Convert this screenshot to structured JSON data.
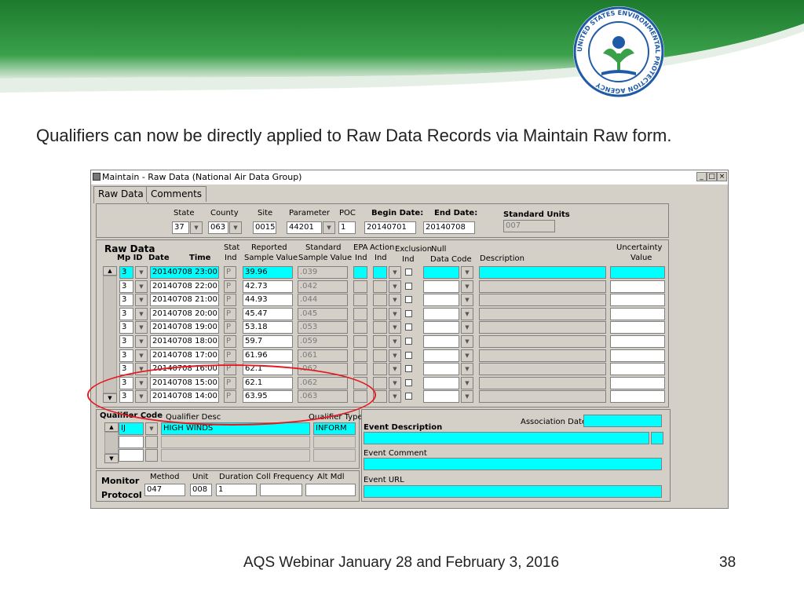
{
  "slide": {
    "caption": "Qualifiers can now be directly applied to Raw Data Records via Maintain Raw form.",
    "footer": "AQS Webinar January 28 and February 3, 2016",
    "page_number": "38",
    "seal_text": "UNITED STATES ENVIRONMENTAL PROTECTION AGENCY"
  },
  "window": {
    "title": "Maintain - Raw Data (National Air Data Group)",
    "tabs": [
      "Raw Data",
      "Comments"
    ]
  },
  "header": {
    "labels": {
      "state": "State",
      "county": "County",
      "site": "Site",
      "parameter": "Parameter",
      "poc": "POC",
      "begin_date": "Begin Date:",
      "end_date": "End Date:",
      "standard_units": "Standard Units"
    },
    "values": {
      "state": "37",
      "county": "063",
      "site": "0015",
      "parameter": "44201",
      "poc": "1",
      "begin_date": "20140701",
      "end_date": "20140708",
      "standard_units": "007"
    }
  },
  "raw_data": {
    "section_title": "Raw Data",
    "col_labels": {
      "mp_id": "Mp ID",
      "date": "Date",
      "time": "Time",
      "stat": "Stat",
      "ind": "Ind",
      "reported": "Reported",
      "sample_value": "Sample Value",
      "standard": "Standard",
      "sample_value2": "Sample  Value",
      "epa": "EPA",
      "action": "Action",
      "epa_ind": "Ind",
      "action_ind": "Ind",
      "exclusion": "Exclusion",
      "excl_ind": "Ind",
      "null": "Null",
      "data_code": "Data Code",
      "description": "Description",
      "uncertainty": "Uncertainty",
      "uncertainty_value": "Value"
    },
    "rows": [
      {
        "mp": "3",
        "datetime": "20140708 23:00",
        "stat": "P",
        "reported": "39.96",
        "standard": ".039"
      },
      {
        "mp": "3",
        "datetime": "20140708 22:00",
        "stat": "P",
        "reported": "42.73",
        "standard": ".042"
      },
      {
        "mp": "3",
        "datetime": "20140708 21:00",
        "stat": "P",
        "reported": "44.93",
        "standard": ".044"
      },
      {
        "mp": "3",
        "datetime": "20140708 20:00",
        "stat": "P",
        "reported": "45.47",
        "standard": ".045"
      },
      {
        "mp": "3",
        "datetime": "20140708 19:00",
        "stat": "P",
        "reported": "53.18",
        "standard": ".053"
      },
      {
        "mp": "3",
        "datetime": "20140708 18:00",
        "stat": "P",
        "reported": "59.7",
        "standard": ".059"
      },
      {
        "mp": "3",
        "datetime": "20140708 17:00",
        "stat": "P",
        "reported": "61.96",
        "standard": ".061"
      },
      {
        "mp": "3",
        "datetime": "20140708 16:00",
        "stat": "P",
        "reported": "62.1",
        "standard": ".062"
      },
      {
        "mp": "3",
        "datetime": "20140708 15:00",
        "stat": "P",
        "reported": "62.1",
        "standard": ".062"
      },
      {
        "mp": "3",
        "datetime": "20140708 14:00",
        "stat": "P",
        "reported": "63.95",
        "standard": ".063"
      }
    ]
  },
  "qualifier": {
    "labels": {
      "code": "Qualifier Code",
      "desc": "Qualifier Desc",
      "type": "Qualifier Type"
    },
    "rows": [
      {
        "code": "IJ",
        "desc": "HIGH WINDS",
        "type": "INFORM"
      }
    ]
  },
  "event": {
    "association_date": "Association Date",
    "description": "Event Description",
    "comment": "Event Comment",
    "url": "Event URL"
  },
  "monitor": {
    "title_line1": "Monitor",
    "title_line2": "Protocol",
    "labels": {
      "method": "Method",
      "unit": "Unit",
      "duration": "Duration",
      "coll_freq": "Coll Frequency",
      "alt_mdl": "Alt Mdl"
    },
    "values": {
      "method": "047",
      "unit": "008",
      "duration": "1",
      "coll_freq": "",
      "alt_mdl": ""
    }
  },
  "colors": {
    "highlight_field": "#00ffff",
    "annotation": "#e31b23",
    "banner_green": "#2e8b3e"
  }
}
